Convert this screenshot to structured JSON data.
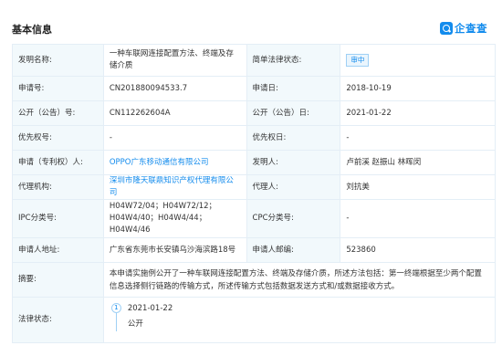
{
  "header": {
    "title": "基本信息",
    "logo_text": "企查查"
  },
  "rows": {
    "invention_name": {
      "label": "发明名称:",
      "value": "一种车联网连接配置方法、终端及存储介质"
    },
    "legal_status_simple": {
      "label": "简单法律状态:",
      "value": "审中"
    },
    "app_no": {
      "label": "申请号:",
      "value": "CN201880094533.7"
    },
    "app_date": {
      "label": "申请日:",
      "value": "2018-10-19"
    },
    "pub_no": {
      "label": "公开（公告）号:",
      "value": "CN112262604A"
    },
    "pub_date": {
      "label": "公开（公告）日:",
      "value": "2021-01-22"
    },
    "priority_no": {
      "label": "优先权号:",
      "value": "-"
    },
    "priority_date": {
      "label": "优先权日:",
      "value": "-"
    },
    "applicant": {
      "label": "申请（专利权）人:",
      "value": "OPPO广东移动通信有限公司"
    },
    "inventor": {
      "label": "发明人:",
      "value": "卢前溪 赵振山 林晖闵"
    },
    "agency": {
      "label": "代理机构:",
      "value": "深圳市隆天联鼎知识产权代理有限公司"
    },
    "agent": {
      "label": "代理人:",
      "value": "刘抗美"
    },
    "ipc": {
      "label": "IPC分类号:",
      "value": "H04W72/04；H04W72/12；H04W4/40；H04W4/44；H04W4/46"
    },
    "cpc": {
      "label": "CPC分类号:",
      "value": "-"
    },
    "address": {
      "label": "申请人地址:",
      "value": "广东省东莞市长安镇乌沙海滨路18号"
    },
    "postcode": {
      "label": "申请人邮编:",
      "value": "523860"
    },
    "abstract": {
      "label": "摘要:",
      "value": "本申请实施例公开了一种车联网连接配置方法、终端及存储介质，所述方法包括：第一终端根据至少两个配置信息选择侧行链路的传输方式，所述传输方式包括数据发送方式和/或数据接收方式。"
    },
    "legal_status": {
      "label": "法律状态:",
      "timeline": [
        {
          "index": "1",
          "date": "2021-01-22",
          "status": "公开"
        }
      ]
    }
  },
  "colors": {
    "accent": "#128bed",
    "label_bg": "#f2f9fc",
    "border": "#e4eef6"
  }
}
